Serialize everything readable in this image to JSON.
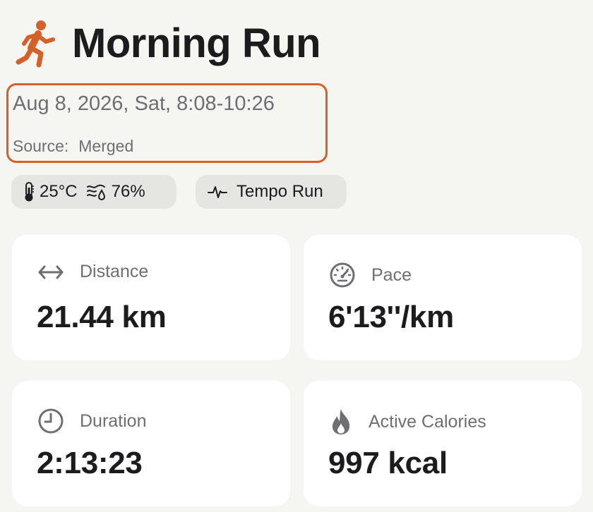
{
  "workout": {
    "title": "Morning Run",
    "date_time": "Aug 8, 2026, Sat, 8:08-10:26",
    "source_label": "Source:",
    "source_value": "Merged",
    "accent_color": "#d4612a"
  },
  "conditions": {
    "temperature": "25°C",
    "humidity": "76%",
    "workout_type": "Tempo Run",
    "icons": [
      "thermometer-icon",
      "humidity-icon",
      "heart-pulse-icon"
    ]
  },
  "stats": [
    {
      "label": "Distance",
      "value": "21.44 km",
      "icon": "distance-icon"
    },
    {
      "label": "Pace",
      "value": "6'13''/km",
      "icon": "speedometer-icon"
    },
    {
      "label": "Duration",
      "value": "2:13:23",
      "icon": "clock-icon"
    },
    {
      "label": "Active Calories",
      "value": "997 kcal",
      "icon": "flame-icon"
    }
  ]
}
